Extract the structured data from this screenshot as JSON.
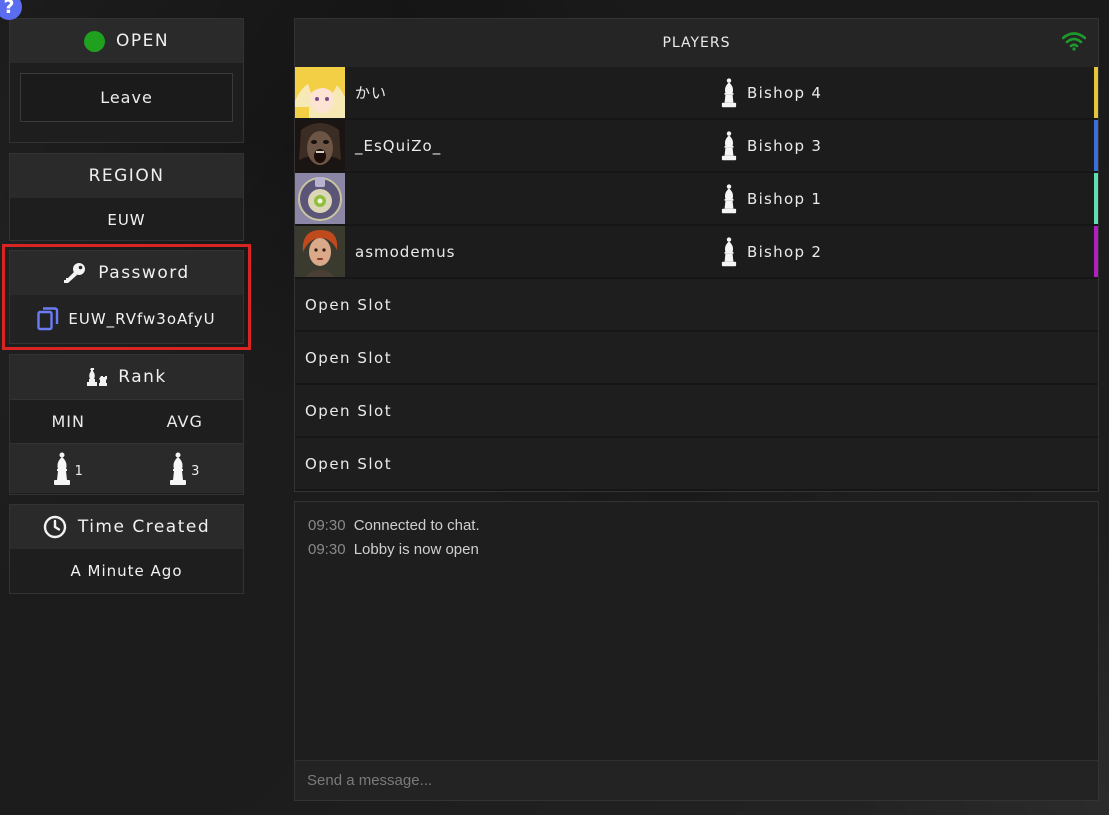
{
  "help": {
    "label": "?"
  },
  "status": {
    "label": "OPEN",
    "color": "#1fa01f"
  },
  "leave": {
    "label": "Leave"
  },
  "region": {
    "title": "REGION",
    "value": "EUW"
  },
  "password": {
    "title": "Password",
    "value": "EUW_RVfw3oAfyU"
  },
  "rank": {
    "title": "Rank",
    "min_label": "MIN",
    "avg_label": "AVG",
    "min_value": "1",
    "avg_value": "3"
  },
  "time_created": {
    "title": "Time Created",
    "value": "A Minute Ago"
  },
  "players": {
    "title": "PLAYERS",
    "rows": [
      {
        "name": "かい",
        "rank": "Bishop 4",
        "color": "#e8c43a",
        "avatar": "blonde-anime-avatar"
      },
      {
        "name": "_EsQuiZo_",
        "rank": "Bishop 3",
        "color": "#3a6ed8",
        "avatar": "screaming-face-avatar"
      },
      {
        "name": "",
        "rank": "Bishop 1",
        "color": "#5ee0b0",
        "avatar": "purple-emblem-avatar"
      },
      {
        "name": "asmodemus",
        "rank": "Bishop 2",
        "color": "#b020c0",
        "avatar": "redhead-woman-avatar"
      }
    ],
    "open_slots": [
      "Open Slot",
      "Open Slot",
      "Open Slot",
      "Open Slot"
    ]
  },
  "chat": {
    "messages": [
      {
        "time": "09:30",
        "text": "Connected to chat."
      },
      {
        "time": "09:30",
        "text": "Lobby is now open"
      }
    ],
    "placeholder": "Send a message..."
  }
}
